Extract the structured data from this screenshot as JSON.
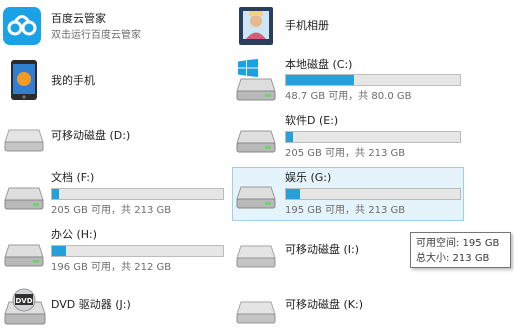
{
  "items": [
    {
      "name": "百度云管家",
      "sub": "双击运行百度云管家"
    },
    {
      "name": "手机相册"
    },
    {
      "name": "我的手机"
    },
    {
      "name": "本地磁盘 (C:)",
      "sub": "48.7 GB 可用，共 80.0 GB",
      "used_fraction": 0.39
    },
    {
      "name": "可移动磁盘 (D:)"
    },
    {
      "name": "软件D (E:)",
      "sub": "205 GB 可用，共 213 GB",
      "used_fraction": 0.04
    },
    {
      "name": "文档 (F:)",
      "sub": "205 GB 可用，共 213 GB",
      "used_fraction": 0.04
    },
    {
      "name": "娱乐 (G:)",
      "sub": "195 GB 可用，共 213 GB",
      "used_fraction": 0.08
    },
    {
      "name": "办公 (H:)",
      "sub": "196 GB 可用，共 212 GB",
      "used_fraction": 0.08
    },
    {
      "name": "可移动磁盘 (I:)"
    },
    {
      "name": "DVD 驱动器 (J:)",
      "icon_label": "DVD"
    },
    {
      "name": "可移动磁盘 (K:)"
    }
  ],
  "tooltip": {
    "line1": "可用空间: 195 GB",
    "line2": "总大小: 213 GB"
  },
  "colors": {
    "bar_fill": "#26a0da",
    "selection": "#e5f3fb",
    "cloud": "#1ba2e6"
  }
}
